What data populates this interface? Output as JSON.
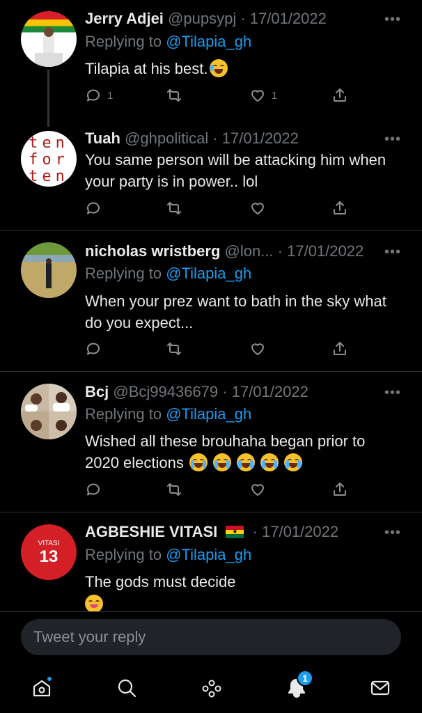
{
  "tweets": [
    {
      "name": "Jerry Adjei",
      "handle": "@pupsypj",
      "date": "· 17/01/2022",
      "replying_label": "Replying to",
      "replying_to": "@Tilapia_gh",
      "text": "Tilapia at his best.",
      "reply_count": "1",
      "retweet_count": "",
      "like_count": "1"
    },
    {
      "name": "Tuah",
      "handle": "@ghpolitical",
      "date": "· 17/01/2022",
      "text": "You same person will be attacking him when your party is in power.. lol",
      "avatar_text": [
        "ten",
        "for",
        "ten"
      ]
    },
    {
      "name": "nicholas wristberg",
      "handle": "@lon...",
      "date": "· 17/01/2022",
      "replying_label": "Replying to",
      "replying_to": "@Tilapia_gh",
      "text": "When your prez want to bath in the sky what do you expect..."
    },
    {
      "name": "Bcj",
      "handle": "@Bcj99436679",
      "date": "· 17/01/2022",
      "replying_label": "Replying to",
      "replying_to": "@Tilapia_gh",
      "text": "Wished all these brouhaha began prior to 2020 elections"
    },
    {
      "name": "AGBESHIE VITASI",
      "handle": "",
      "date": "· 17/01/2022",
      "replying_label": "Replying to",
      "replying_to": "@Tilapia_gh",
      "text": "The gods must decide",
      "avatar_label": "VITASI",
      "avatar_number": "13"
    }
  ],
  "more_label": "•••",
  "compose": {
    "placeholder": "Tweet your reply"
  },
  "nav": {
    "notifications_badge": "1"
  },
  "colors": {
    "accent": "#1d9bf0",
    "background": "#000000",
    "muted": "#71767b"
  }
}
